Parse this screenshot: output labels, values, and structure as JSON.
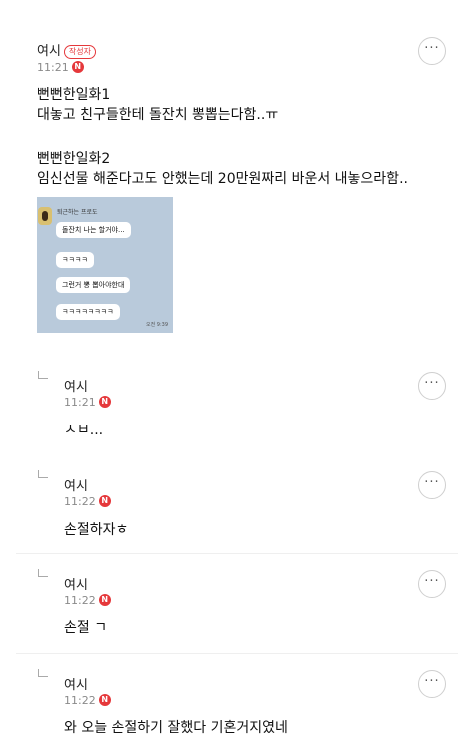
{
  "main_post": {
    "author": "여시",
    "writer_badge": "작성자",
    "time": "11:21",
    "n_badge": "N",
    "more": "···",
    "lines": [
      "뻔뻔한일화1",
      "대놓고 친구들한테 돌잔치 뽕뽑는다함..ㅠ",
      "뻔뻔한일화2",
      "임신선물 해준다고도 안했는데 20만원짜리 바운서 내놓으라함.."
    ]
  },
  "chat_image": {
    "sender": "퇴근하는 프로도",
    "bubbles": [
      "돌잔치 나는 할거야...",
      "ㅋㅋㅋㅋ",
      "그런거 뽕 뽑아야한대",
      "ㅋㅋㅋㅋㅋㅋㅋㅋ"
    ],
    "time": "오전 9:39"
  },
  "replies": [
    {
      "author": "여시",
      "time": "11:21",
      "text": "ㅅㅂ..."
    },
    {
      "author": "여시",
      "time": "11:22",
      "text": "손절하자ㅎ"
    },
    {
      "author": "여시",
      "time": "11:22",
      "text": "손절 ㄱ"
    },
    {
      "author": "여시",
      "time": "11:22",
      "text": "와 오늘 손절하기 잘했다 기혼거지였네"
    }
  ]
}
